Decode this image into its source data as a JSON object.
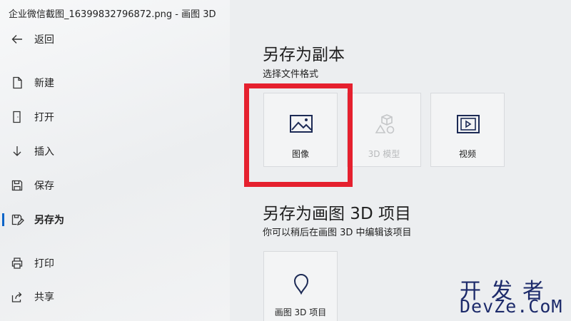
{
  "window": {
    "title": "企业微信截图_16399832796872.png - 画图 3D"
  },
  "sidebar": {
    "items": [
      {
        "label": "返回",
        "icon": "back-arrow-icon"
      },
      {
        "label": "新建",
        "icon": "new-file-icon"
      },
      {
        "label": "打开",
        "icon": "open-icon"
      },
      {
        "label": "插入",
        "icon": "insert-icon"
      },
      {
        "label": "保存",
        "icon": "save-icon"
      },
      {
        "label": "另存为",
        "icon": "save-as-icon",
        "active": true
      },
      {
        "label": "打印",
        "icon": "print-icon"
      },
      {
        "label": "共享",
        "icon": "share-icon"
      }
    ],
    "accent_color": "#0a64c8"
  },
  "save_copy": {
    "heading": "另存为副本",
    "subheading": "选择文件格式",
    "tiles": [
      {
        "label": "图像",
        "icon": "image-icon",
        "enabled": true,
        "highlighted": true
      },
      {
        "label": "3D 模型",
        "icon": "3d-model-icon",
        "enabled": false
      },
      {
        "label": "视频",
        "icon": "video-icon",
        "enabled": true
      }
    ]
  },
  "save_project": {
    "heading": "另存为画图 3D 项目",
    "subheading": "你可以稍后在画图 3D 中编辑该项目",
    "tiles": [
      {
        "label": "画图 3D 项目",
        "icon": "paint3d-project-icon",
        "enabled": true
      }
    ]
  },
  "highlight_color": "#e5202e",
  "watermark": {
    "cn": "开发者",
    "en": "DevZe.CoM"
  }
}
